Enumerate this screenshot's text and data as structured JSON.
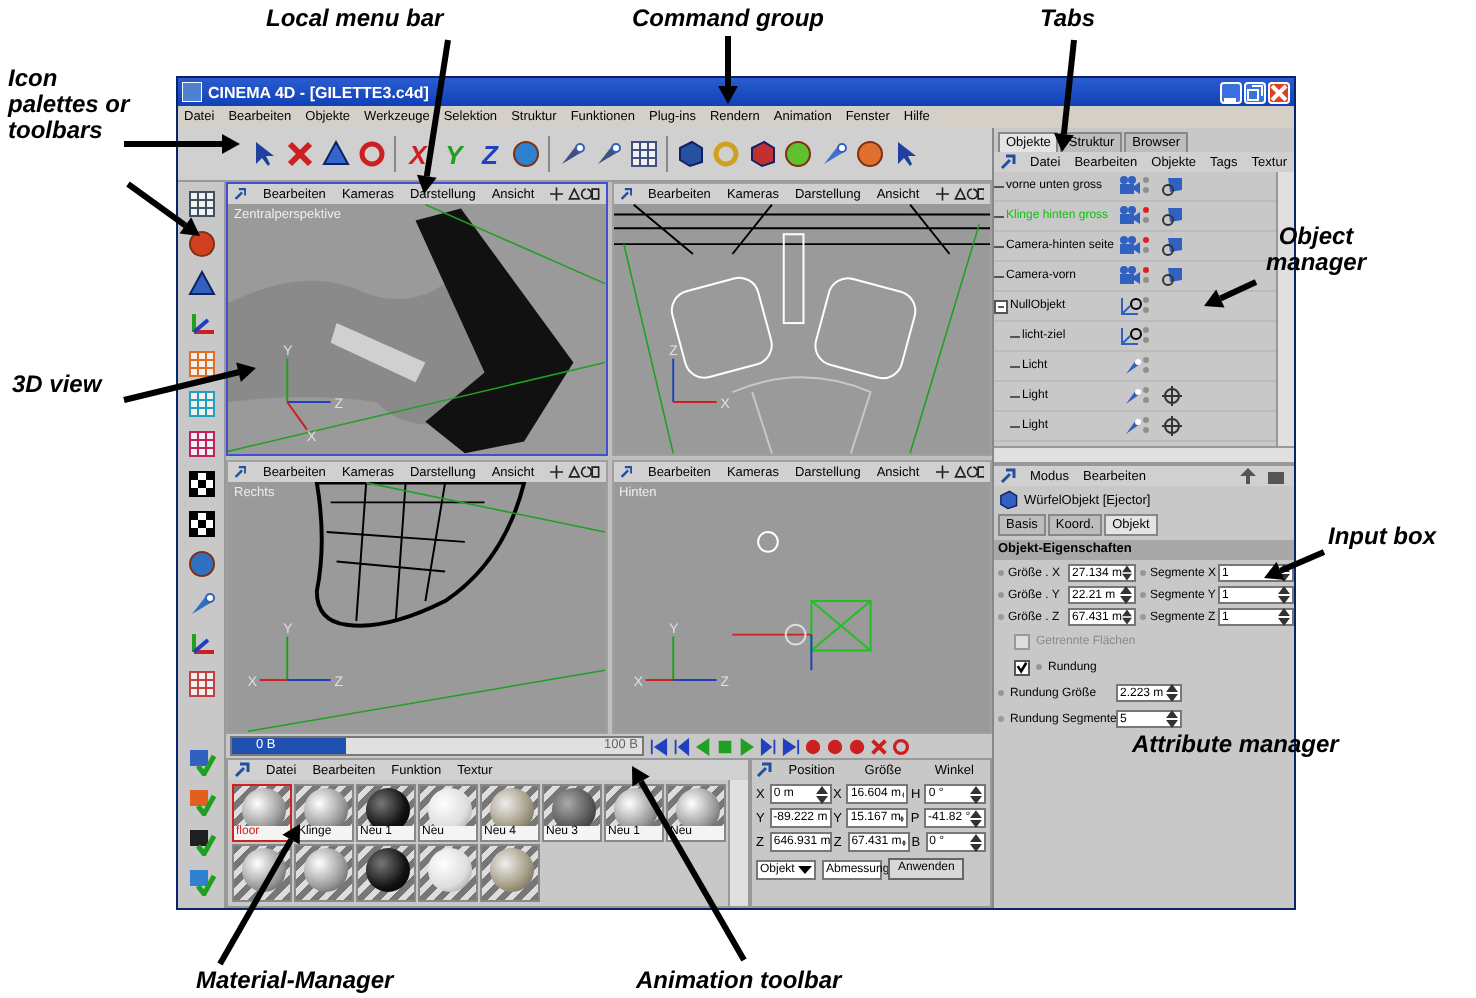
{
  "annotations": [
    {
      "text": "Local menu bar"
    },
    {
      "text": "Command group"
    },
    {
      "text": "Tabs"
    },
    {
      "text": "Icon palettes or toolbars"
    },
    {
      "text": "Object manager"
    },
    {
      "text": "3D view"
    },
    {
      "text": "Input box"
    },
    {
      "text": "Attribute manager"
    },
    {
      "text": "Material-Manager"
    },
    {
      "text": "Animation toolbar"
    }
  ],
  "window": {
    "title": "CINEMA 4D - [GILETTE3.c4d]"
  },
  "main_menu": [
    "Datei",
    "Bearbeiten",
    "Objekte",
    "Werkzeuge",
    "Selektion",
    "Struktur",
    "Funktionen",
    "Plug-ins",
    "Rendern",
    "Animation",
    "Fenster",
    "Hilfe"
  ],
  "axis_buttons": [
    "X",
    "Y",
    "Z"
  ],
  "viewports": [
    {
      "label": "Zentralperspektive",
      "selected": true,
      "kind": "render",
      "menu": [
        "Bearbeiten",
        "Kameras",
        "Darstellung",
        "Ansicht"
      ],
      "axes": {
        "up": "Y",
        "right": "Z",
        "down": "X"
      }
    },
    {
      "selected": false,
      "kind": "front",
      "menu": [
        "Bearbeiten",
        "Kameras",
        "Darstellung",
        "Ansicht"
      ],
      "axes": {
        "up": "Z",
        "right": "X"
      }
    },
    {
      "label": "Rechts",
      "selected": false,
      "kind": "side",
      "menu": [
        "Bearbeiten",
        "Kameras",
        "Darstellung",
        "Ansicht"
      ],
      "axes": {
        "up": "Y",
        "left": "X",
        "right": "Z"
      }
    },
    {
      "label": "Hinten",
      "selected": false,
      "kind": "back",
      "menu": [
        "Bearbeiten",
        "Kameras",
        "Darstellung",
        "Ansicht"
      ],
      "axes": {
        "up": "Y",
        "left": "X",
        "right": "Z"
      }
    }
  ],
  "timeline": {
    "start": "0 B",
    "end": "100 B",
    "level": 0.28
  },
  "material_manager": {
    "menu": [
      "Datei",
      "Bearbeiten",
      "Funktion",
      "Textur"
    ],
    "materials": [
      {
        "name": "floor",
        "selected": true
      },
      {
        "name": "Klinge",
        "selected": false
      },
      {
        "name": "Neu 1",
        "selected": false
      },
      {
        "name": "Neu",
        "selected": false
      },
      {
        "name": "Neu 4",
        "selected": false
      },
      {
        "name": "Neu 3",
        "selected": false
      },
      {
        "name": "Neu 1",
        "selected": false
      },
      {
        "name": "Neu",
        "selected": false
      },
      {
        "selected": false
      },
      {
        "selected": false
      },
      {
        "selected": false
      },
      {
        "selected": false
      },
      {
        "selected": false
      }
    ]
  },
  "coordinates": {
    "headers": [
      "Position",
      "Größe",
      "Winkel"
    ],
    "rows": [
      [
        {
          "axis": "X",
          "value": "0 m"
        },
        {
          "axis": "X",
          "value": "16.604 m"
        },
        {
          "axis": "H",
          "value": "0 °"
        }
      ],
      [
        {
          "axis": "Y",
          "value": "-89.222 m"
        },
        {
          "axis": "Y",
          "value": "15.167 m"
        },
        {
          "axis": "P",
          "value": "-41.82 °"
        }
      ],
      [
        {
          "axis": "Z",
          "value": "646.931 m"
        },
        {
          "axis": "Z",
          "value": "67.431 m"
        },
        {
          "axis": "B",
          "value": "0 °"
        }
      ]
    ],
    "dropdowns": [
      "Objekt",
      "Abmessung"
    ],
    "apply_button": "Anwenden"
  },
  "object_manager": {
    "tabs": [
      {
        "label": "Objekte",
        "selected": true
      },
      {
        "label": "Struktur",
        "selected": false
      },
      {
        "label": "Browser",
        "selected": false
      }
    ],
    "menu": [
      "Datei",
      "Bearbeiten",
      "Objekte",
      "Tags",
      "Textur"
    ],
    "objects": [
      {
        "name": "vorne unten gross",
        "kind": "camera",
        "selected": false,
        "active": false,
        "tags": [
          {
            "kind": "camera"
          }
        ]
      },
      {
        "name": "Klinge hinten gross",
        "kind": "camera",
        "selected": true,
        "active": true,
        "tags": [
          {
            "kind": "camera"
          }
        ]
      },
      {
        "name": "Camera-hinten seite",
        "kind": "camera",
        "selected": false,
        "active": true,
        "tags": [
          {
            "kind": "camera"
          }
        ]
      },
      {
        "name": "Camera-vorn",
        "kind": "camera",
        "selected": false,
        "active": true,
        "tags": [
          {
            "kind": "camera"
          }
        ]
      },
      {
        "name": "NullObjekt",
        "kind": "null",
        "selected": false,
        "active": false,
        "expanded": true,
        "children": [
          {
            "name": "licht-ziel",
            "kind": "null",
            "selected": false,
            "active": false
          },
          {
            "name": "Licht",
            "kind": "light",
            "selected": false,
            "active": false
          },
          {
            "name": "Light",
            "kind": "light",
            "selected": false,
            "active": false,
            "tags": [
              {
                "kind": "target"
              }
            ]
          },
          {
            "name": "Light",
            "kind": "light",
            "selected": false,
            "active": false,
            "tags": [
              {
                "kind": "target"
              }
            ]
          }
        ]
      }
    ]
  },
  "attribute_manager": {
    "menu": [
      "Modus",
      "Bearbeiten"
    ],
    "object": "WürfelObjekt [Ejector]",
    "tabs": [
      {
        "label": "Basis",
        "selected": false
      },
      {
        "label": "Koord.",
        "selected": false
      },
      {
        "label": "Objekt",
        "selected": true
      }
    ],
    "section": "Objekt-Eigenschaften",
    "fields": [
      {
        "label": "Größe . X",
        "value": "27.134 m",
        "segment_label": "Segmente X",
        "segment_value": "1"
      },
      {
        "label": "Größe . Y",
        "value": "22.21 m",
        "segment_label": "Segmente Y",
        "segment_value": "1"
      },
      {
        "label": "Größe . Z",
        "value": "67.431 m",
        "segment_label": "Segmente Z",
        "segment_value": "1"
      }
    ],
    "options": [
      {
        "kind": "checkbox",
        "label": "Getrennte Flächen",
        "checked": false,
        "disabled": true
      },
      {
        "kind": "checkbox",
        "label": "Rundung",
        "checked": true,
        "disabled": false
      },
      {
        "kind": "number",
        "label": "Rundung Größe",
        "value": "2.223 m"
      },
      {
        "kind": "number",
        "label": "Rundung Segmente",
        "value": "5"
      }
    ]
  }
}
